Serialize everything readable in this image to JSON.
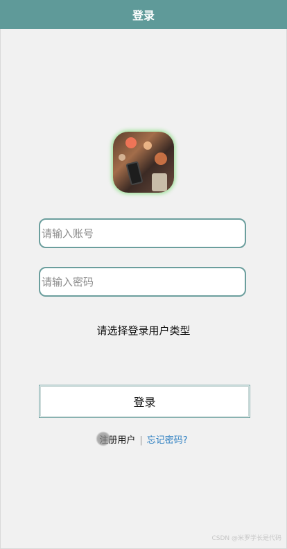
{
  "header": {
    "title": "登录"
  },
  "form": {
    "username_placeholder": "请输入账号",
    "password_placeholder": "请输入密码",
    "user_type_label": "请选择登录用户类型",
    "submit_label": "登录"
  },
  "links": {
    "register": "注册用户",
    "separator": "|",
    "forgot": "忘记密码?"
  },
  "footer": {
    "watermark": "CSDN @米罗学长是代码"
  },
  "colors": {
    "header_bg": "#5f9a99",
    "input_border": "#6b9e9d",
    "link": "#2d7fc1"
  }
}
